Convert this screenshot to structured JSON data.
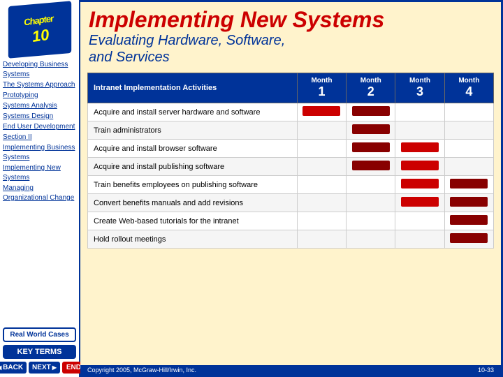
{
  "sidebar": {
    "chapter_label": "Chapter",
    "chapter_number": "10",
    "nav_links": [
      "Developing Business Systems",
      "The Systems Approach",
      "Prototyping",
      "Systems Analysis",
      "Systems Design",
      "End User Development",
      "Section II",
      "Implementing Business Systems",
      "Implementing New Systems",
      "Managing Organizational Change"
    ],
    "real_world_cases": "Real World Cases",
    "key_terms": "KEY TERMS",
    "back_label": "BACK",
    "next_label": "NEXT",
    "end_label": "END"
  },
  "header": {
    "title": "Implementing New Systems",
    "subtitle_line1": "Evaluating Hardware, Software,",
    "subtitle_line2": "and Services"
  },
  "table": {
    "header": {
      "activity_col": "Intranet Implementation Activities",
      "months": [
        {
          "label": "Month",
          "number": "1"
        },
        {
          "label": "Month",
          "number": "2"
        },
        {
          "label": "Month",
          "number": "3"
        },
        {
          "label": "Month",
          "number": "4"
        }
      ]
    },
    "rows": [
      {
        "activity": "Acquire and install server hardware and software",
        "bars": [
          true,
          true,
          false,
          false
        ]
      },
      {
        "activity": "Train administrators",
        "bars": [
          false,
          true,
          false,
          false
        ]
      },
      {
        "activity": "Acquire and install browser software",
        "bars": [
          false,
          true,
          true,
          false
        ]
      },
      {
        "activity": "Acquire and install publishing software",
        "bars": [
          false,
          true,
          true,
          false
        ]
      },
      {
        "activity": "Train benefits employees on publishing software",
        "bars": [
          false,
          false,
          true,
          true
        ]
      },
      {
        "activity": "Convert benefits manuals and add revisions",
        "bars": [
          false,
          false,
          true,
          true
        ]
      },
      {
        "activity": "Create Web-based tutorials for the intranet",
        "bars": [
          false,
          false,
          false,
          true
        ]
      },
      {
        "activity": "Hold rollout meetings",
        "bars": [
          false,
          false,
          false,
          true
        ]
      }
    ]
  },
  "footer": {
    "copyright": "Copyright 2005, McGraw-Hill/Irwin, Inc.",
    "page": "10-33"
  }
}
